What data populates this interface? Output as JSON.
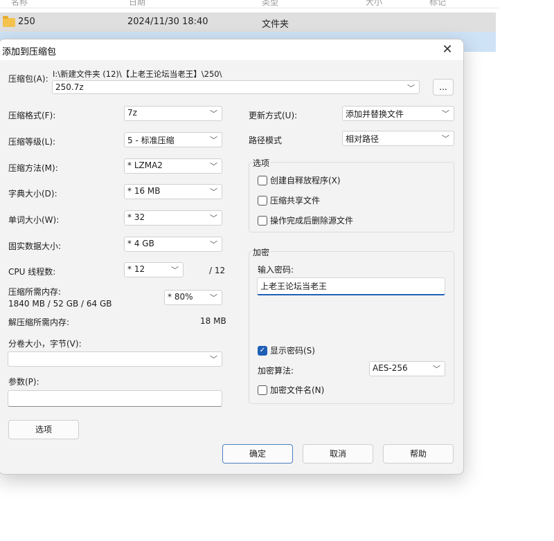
{
  "explorer": {
    "headers": [
      "名称",
      "日期",
      "类型",
      "大小",
      "标记"
    ],
    "rows": [
      {
        "name": "250",
        "date": "2024/11/30 18:40",
        "type": "文件夹"
      }
    ]
  },
  "dialog": {
    "title": "添加到压缩包",
    "archive_label": "压缩包(A):",
    "archive_path": "I:\\新建文件夹 (12)\\【上老王论坛当老王】\\250\\",
    "archive_name": "250.7z",
    "browse_label": "...",
    "left": {
      "format_label": "压缩格式(F):",
      "format_value": "7z",
      "level_label": "压缩等级(L):",
      "level_value": "5 - 标准压缩",
      "method_label": "压缩方法(M):",
      "method_value": "* LZMA2",
      "dict_label": "字典大小(D):",
      "dict_value": "* 16 MB",
      "word_label": "单词大小(W):",
      "word_value": "* 32",
      "solid_label": "固实数据大小:",
      "solid_value": "* 4 GB",
      "threads_label": "CPU 线程数:",
      "threads_value": "* 12",
      "threads_total": "/ 12",
      "mem_label": "压缩所需内存:",
      "mem_detail": "1840 MB / 52 GB / 64 GB",
      "mem_value": "* 80%",
      "decomp_label": "解压缩所需内存:",
      "decomp_value": "18 MB",
      "split_label": "分卷大小，字节(V):",
      "split_value": "",
      "params_label": "参数(P):",
      "params_value": "",
      "options_button": "选项"
    },
    "right": {
      "update_label": "更新方式(U):",
      "update_value": "添加并替换文件",
      "path_label": "路径模式",
      "path_value": "相对路径",
      "options_group": "选项",
      "opt_sfx": "创建自释放程序(X)",
      "opt_shared": "压缩共享文件",
      "opt_delete": "操作完成后删除源文件",
      "encrypt_group": "加密",
      "password_label": "输入密码:",
      "password_value": "上老王论坛当老王",
      "show_password": "显示密码(S)",
      "algo_label": "加密算法:",
      "algo_value": "AES-256",
      "encrypt_names": "加密文件名(N)"
    },
    "buttons": {
      "ok": "确定",
      "cancel": "取消",
      "help": "帮助"
    }
  },
  "accent_color": "#1f5fb6"
}
